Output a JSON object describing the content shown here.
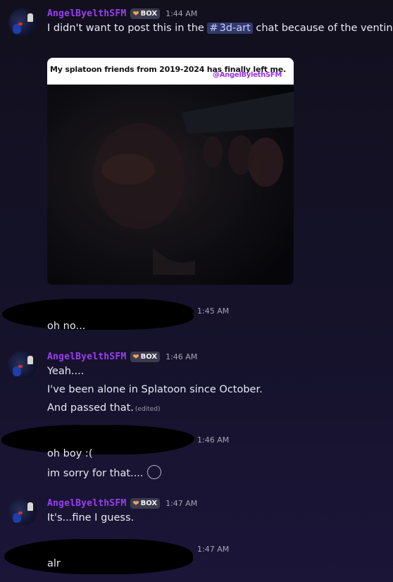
{
  "messages": [
    {
      "username": "AngelByelthSFM",
      "badge": "BOX",
      "time": "1:44 AM",
      "text_before": "I didn't want to post this in the",
      "channel_mention": "3d-art",
      "text_after": "chat because of the venting.",
      "image": {
        "caption": "My splatoon friends from 2019-2024 has finally left me.",
        "handle": "@AngelBylethSFM"
      }
    },
    {
      "time": "1:45 AM",
      "lines": [
        "oh no..."
      ]
    },
    {
      "username": "AngelByelthSFM",
      "badge": "BOX",
      "time": "1:46 AM",
      "lines": [
        "Yeah....",
        "I've been alone in Splatoon since October.",
        "And passed that."
      ],
      "edited_label": "(edited)"
    },
    {
      "time": "1:46 AM",
      "lines": [
        "oh boy :(",
        "im sorry for that...."
      ]
    },
    {
      "username": "AngelByelthSFM",
      "badge": "BOX",
      "time": "1:47 AM",
      "lines": [
        "It's...fine I guess."
      ]
    },
    {
      "time": "1:47 AM",
      "lines": [
        "alr"
      ]
    }
  ],
  "colors": {
    "username": "#9a3ff0",
    "mention_bg": "#33386b",
    "badge_bg": "#3d3b4f",
    "background": "#15122a"
  }
}
